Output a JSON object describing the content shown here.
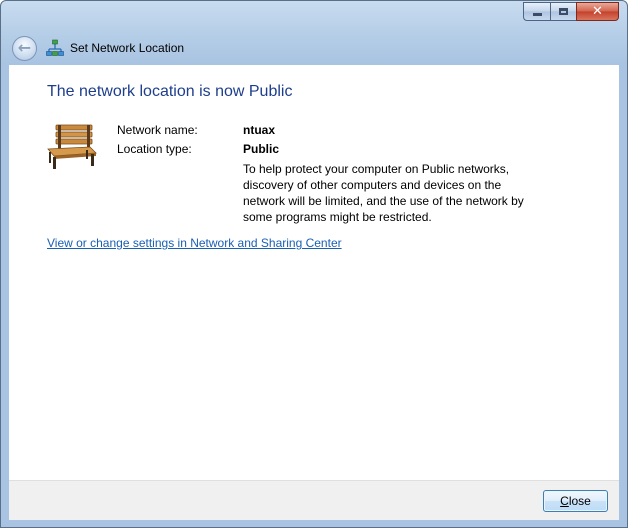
{
  "window": {
    "title": "Set Network Location"
  },
  "content": {
    "heading": "The network location is now Public",
    "network_name_label": "Network name:",
    "network_name_value": "ntuax",
    "location_type_label": "Location type:",
    "location_type_value": "Public",
    "description": "To help protect your computer on Public networks, discovery of other computers and devices on the network will be limited, and the use of the network by some programs might be restricted.",
    "settings_link": "View or change settings in Network and Sharing Center"
  },
  "footer": {
    "close_label_first": "C",
    "close_label_rest": "lose"
  },
  "icons": {
    "back": "back-arrow-icon",
    "network": "network-icon",
    "bench": "public-bench-icon"
  },
  "colors": {
    "heading": "#1e3e8c",
    "link": "#1a5fb4",
    "close_caption": "#c4402a"
  }
}
